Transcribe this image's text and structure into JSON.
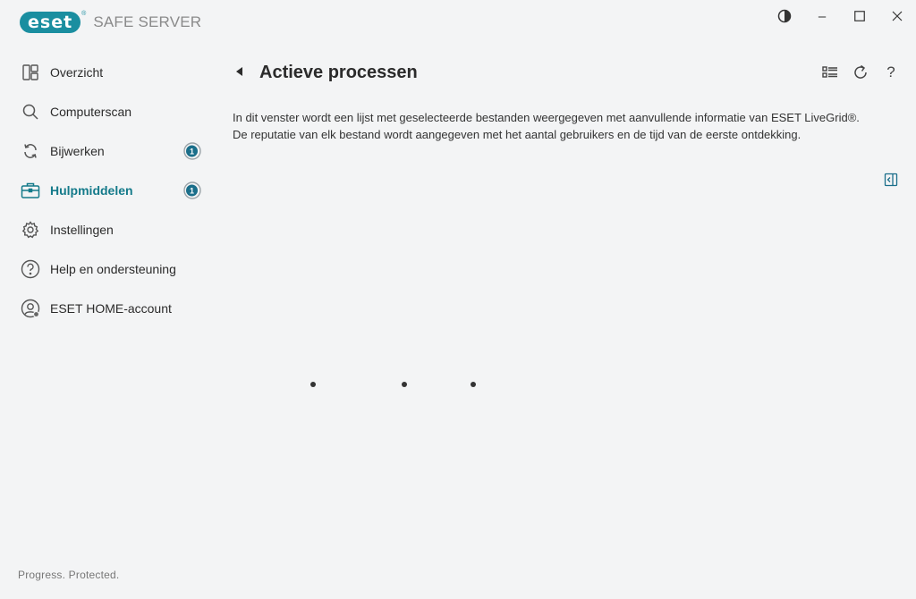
{
  "app": {
    "logo_text": "eset",
    "logo_reg": "®",
    "product": "SAFE SERVER",
    "tagline": "Progress. Protected."
  },
  "window_controls": {
    "theme_icon": "half-circle-icon",
    "minimize": "–",
    "maximize": "☐",
    "close": "✕"
  },
  "sidebar": {
    "items": [
      {
        "label": "Overzicht",
        "icon": "dashboard-icon"
      },
      {
        "label": "Computerscan",
        "icon": "magnifier-icon"
      },
      {
        "label": "Bijwerken",
        "icon": "refresh-icon",
        "badge": "1"
      },
      {
        "label": "Hulpmiddelen",
        "icon": "briefcase-icon",
        "badge": "1",
        "active": true
      },
      {
        "label": "Instellingen",
        "icon": "gear-icon"
      },
      {
        "label": "Help en ondersteuning",
        "icon": "question-icon"
      },
      {
        "label": "ESET HOME-account",
        "icon": "user-account-icon"
      }
    ]
  },
  "main": {
    "title": "Actieve processen",
    "description_line1": "In dit venster wordt een lijst met geselecteerde bestanden weergegeven met aanvullende informatie van ESET LiveGrid®.",
    "description_line2": "De reputatie van elk bestand wordt aangegeven met het aantal gebruikers en de tijd van de eerste ontdekking.",
    "help_label": "?"
  },
  "colors": {
    "accent": "#1a8ea0",
    "active_text": "#147a8a",
    "background": "#f3f4f5"
  }
}
